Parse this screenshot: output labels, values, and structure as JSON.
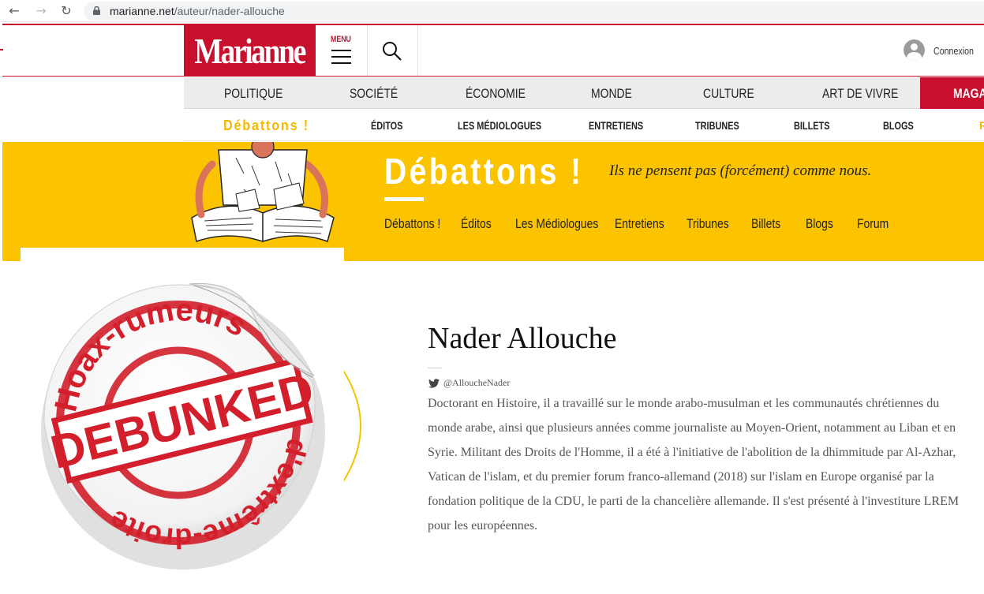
{
  "browser": {
    "url_host": "marianne.net",
    "url_path": "/auteur/nader-allouche"
  },
  "header": {
    "logo": "Marianne",
    "menu_label": "MENU",
    "account_label": "Connexion"
  },
  "main_nav": {
    "items": [
      "POLITIQUE",
      "SOCIÉTÉ",
      "ÉCONOMIE",
      "MONDE",
      "CULTURE",
      "ART DE VIVRE"
    ],
    "highlight": "MAGAZ"
  },
  "sub_nav": {
    "brand": "Débattons !",
    "items": [
      "ÉDITOS",
      "LES MÉDIOLOGUES",
      "ENTRETIENS",
      "TRIBUNES",
      "BILLETS",
      "BLOGS"
    ],
    "trailing": "F"
  },
  "banner": {
    "title": "Débattons !",
    "tagline": "Ils ne pensent pas (forcément) comme nous.",
    "nav": [
      "Débattons !",
      "Éditos",
      "Les Médiologues",
      "Entretiens",
      "Tribunes",
      "Billets",
      "Blogs",
      "Forum"
    ],
    "colors": {
      "background": "#fcc400",
      "brand_red": "#c8102e"
    }
  },
  "sticker": {
    "top_text": "Hoax-rumeurs",
    "stamp_text": "DEBUNKED",
    "bottom_text": "d'extrême-droite"
  },
  "author": {
    "name": "Nader Allouche",
    "twitter": "@AlloucheNader",
    "bio": "Doctorant en Histoire, il a travaillé sur le monde arabo-musulman et les communautés chrétiennes du monde arabe, ainsi que plusieurs années comme journaliste au Moyen-Orient, notamment au Liban et en Syrie. Militant des Droits de l'Homme, il a été à l'initiative de l'abolition de la dhimmitude par Al-Azhar, Vatican de l'islam, et du premier forum franco-allemand (2018) sur l'islam en Europe organisé par la fondation politique de la CDU, le parti de la chancelière allemande. Il s'est présenté à l'investiture LREM pour les européennes."
  }
}
